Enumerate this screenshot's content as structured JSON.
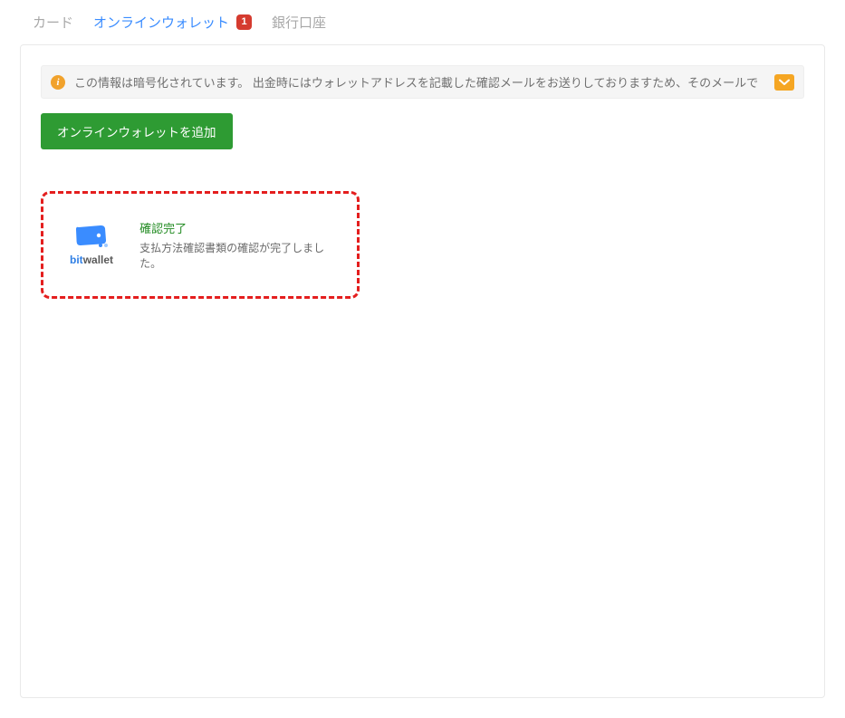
{
  "tabs": {
    "card": "カード",
    "online_wallet": "オンラインウォレット",
    "badge_count": "1",
    "bank_account": "銀行口座"
  },
  "alert": {
    "info_glyph": "i",
    "text": "この情報は暗号化されています。 出金時にはウォレットアドレスを記載した確認メールをお送りしておりますため、そのメールで"
  },
  "buttons": {
    "add_wallet": "オンラインウォレットを追加"
  },
  "wallet_card": {
    "logo": {
      "bit": "bit",
      "wallet": "wallet"
    },
    "status_title": "確認完了",
    "status_desc": "支払方法確認書類の確認が完了しました。"
  }
}
